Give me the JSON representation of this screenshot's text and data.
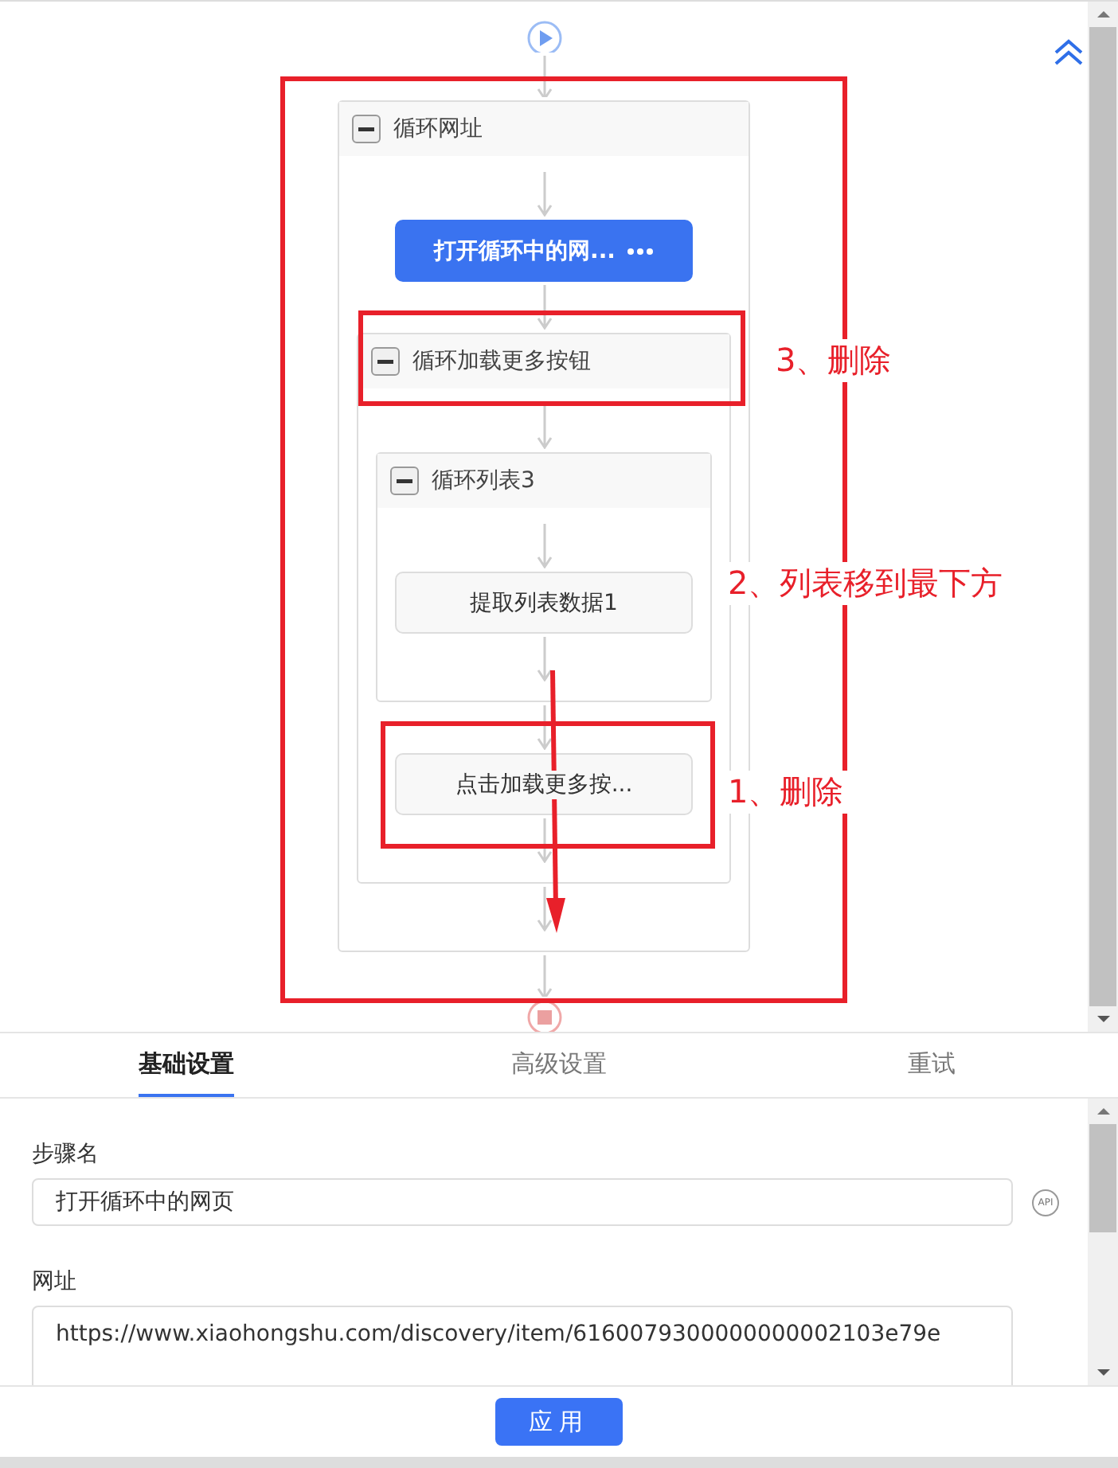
{
  "flow": {
    "children": [
      {
        "kind": "loop",
        "label": "循环网址",
        "expanded": true,
        "children": [
          {
            "kind": "action",
            "label": "打开循环中的网...",
            "selected": true
          },
          {
            "kind": "loop",
            "label": "循环加载更多按钮",
            "expanded": true,
            "children": [
              {
                "kind": "loop",
                "label": "循环列表3",
                "expanded": true,
                "children": [
                  {
                    "kind": "action",
                    "label": "提取列表数据1",
                    "selected": false
                  }
                ]
              },
              {
                "kind": "action",
                "label": "点击加载更多按...",
                "selected": false
              }
            ]
          }
        ]
      }
    ]
  },
  "annotations": [
    {
      "text": "3、删除"
    },
    {
      "text": "2、列表移到最下方"
    },
    {
      "text": "1、删除"
    }
  ],
  "tabs": [
    {
      "label": "基础设置",
      "selected": true
    },
    {
      "label": "高级设置",
      "selected": false
    },
    {
      "label": "重试",
      "selected": false
    }
  ],
  "fields": [
    {
      "label": "步骤名",
      "value": "打开循环中的网页",
      "kind": "input",
      "badge": "API"
    },
    {
      "label": "网址",
      "value": "https://www.xiaohongshu.com/discovery/item/6160079300000000002103e79e",
      "kind": "textarea"
    }
  ],
  "apply_button": "应用"
}
